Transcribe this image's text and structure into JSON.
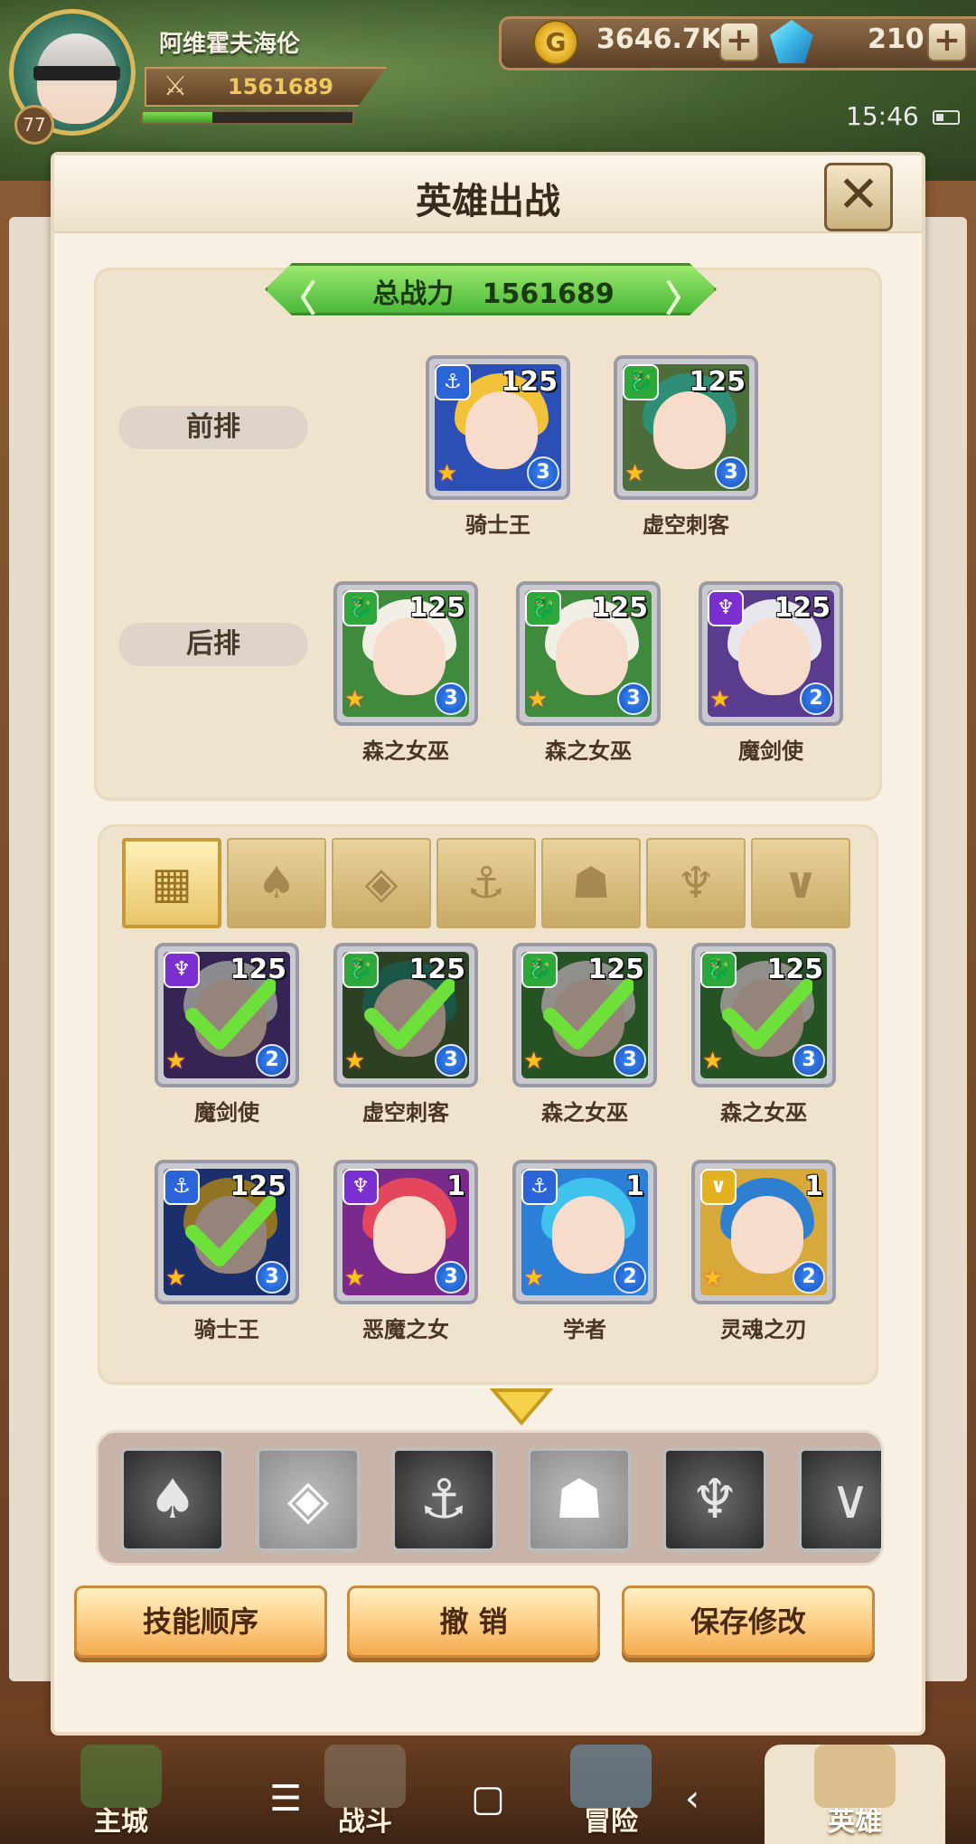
{
  "player": {
    "name": "阿维霍夫海伦",
    "level": "77",
    "power": "1561689",
    "exp_fraction": 0.33
  },
  "currency": {
    "coins": "3646.7K",
    "gems": "210"
  },
  "status": {
    "time": "15:46"
  },
  "dialog": {
    "title": "英雄出战",
    "close_label": "✕",
    "total_power_label": "总战力   1561689"
  },
  "lineup": {
    "front_label": "前排",
    "back_label": "后排",
    "front": [
      {
        "name": "骑士王",
        "level": "125",
        "rank": "3",
        "class_icon": "⚓",
        "class_color": "#2b63d8",
        "hair": "#f2c23a",
        "bg": "#2b4fb4"
      },
      {
        "name": "虚空刺客",
        "level": "125",
        "rank": "3",
        "class_icon": "🐉",
        "class_color": "#2fa83b",
        "hair": "#2f8f76",
        "bg": "#4a6d3a"
      }
    ],
    "back": [
      {
        "name": "森之女巫",
        "level": "125",
        "rank": "3",
        "class_icon": "🐉",
        "class_color": "#2fa83b",
        "hair": "#f2efe6",
        "bg": "#3f8a3c"
      },
      {
        "name": "森之女巫",
        "level": "125",
        "rank": "3",
        "class_icon": "🐉",
        "class_color": "#2fa83b",
        "hair": "#f2efe6",
        "bg": "#3f8a3c"
      },
      {
        "name": "魔剑使",
        "level": "125",
        "rank": "2",
        "class_icon": "♆",
        "class_color": "#7c2fd0",
        "hair": "#e9e7ee",
        "bg": "#5a3c8e"
      }
    ]
  },
  "roster": {
    "filters": [
      {
        "icon": "grid-icon",
        "glyph": "▦",
        "active": true
      },
      {
        "icon": "leaf-class-icon",
        "glyph": "♠"
      },
      {
        "icon": "diamond-class-icon",
        "glyph": "◈"
      },
      {
        "icon": "anchor-class-icon",
        "glyph": "⚓"
      },
      {
        "icon": "dragon-class-icon",
        "glyph": "☗"
      },
      {
        "icon": "demon-class-icon",
        "glyph": "♆"
      },
      {
        "icon": "wing-class-icon",
        "glyph": "∨"
      }
    ],
    "heroes": [
      {
        "name": "魔剑使",
        "level": "125",
        "rank": "2",
        "class_icon": "♆",
        "class_color": "#7c2fd0",
        "hair": "#e9e7ee",
        "bg": "#5a3c8e",
        "selected": true
      },
      {
        "name": "虚空刺客",
        "level": "125",
        "rank": "3",
        "class_icon": "🐉",
        "class_color": "#2fa83b",
        "hair": "#2f8f76",
        "bg": "#4a6d3a",
        "selected": true
      },
      {
        "name": "森之女巫",
        "level": "125",
        "rank": "3",
        "class_icon": "🐉",
        "class_color": "#2fa83b",
        "hair": "#f2efe6",
        "bg": "#3f8a3c",
        "selected": true
      },
      {
        "name": "森之女巫",
        "level": "125",
        "rank": "3",
        "class_icon": "🐉",
        "class_color": "#2fa83b",
        "hair": "#f2efe6",
        "bg": "#3f8a3c",
        "selected": true
      },
      {
        "name": "骑士王",
        "level": "125",
        "rank": "3",
        "class_icon": "⚓",
        "class_color": "#2b63d8",
        "hair": "#f2c23a",
        "bg": "#2b4fb4",
        "selected": true
      },
      {
        "name": "恶魔之女",
        "level": "1",
        "rank": "3",
        "class_icon": "♆",
        "class_color": "#7c2fd0",
        "hair": "#e4475d",
        "bg": "#7a2a8a",
        "selected": false
      },
      {
        "name": "学者",
        "level": "1",
        "rank": "2",
        "class_icon": "⚓",
        "class_color": "#2b63d8",
        "hair": "#3fc3ec",
        "bg": "#2c7fd6",
        "selected": false
      },
      {
        "name": "灵魂之刃",
        "level": "1",
        "rank": "2",
        "class_icon": "∨",
        "class_color": "#e4b21e",
        "hair": "#2f7fd0",
        "bg": "#d7a93a",
        "selected": false
      }
    ]
  },
  "class_strip": [
    {
      "icon": "leaf-class-icon",
      "glyph": "♠"
    },
    {
      "icon": "diamond-class-icon",
      "glyph": "◈"
    },
    {
      "icon": "anchor-class-icon",
      "glyph": "⚓"
    },
    {
      "icon": "dragon-class-icon",
      "glyph": "☗"
    },
    {
      "icon": "demon-class-icon",
      "glyph": "♆"
    },
    {
      "icon": "wing-class-icon",
      "glyph": "∨"
    }
  ],
  "actions": {
    "skill_order": "技能顺序",
    "undo": "撤 销",
    "save": "保存修改"
  },
  "nav": {
    "city": "主城",
    "battle": "战斗",
    "adventure": "冒险",
    "heroes": "英雄"
  },
  "colors": {
    "accent_green": "#4bb83a",
    "button_orange": "#f3a94e",
    "title_text": "#3a2a1c"
  }
}
